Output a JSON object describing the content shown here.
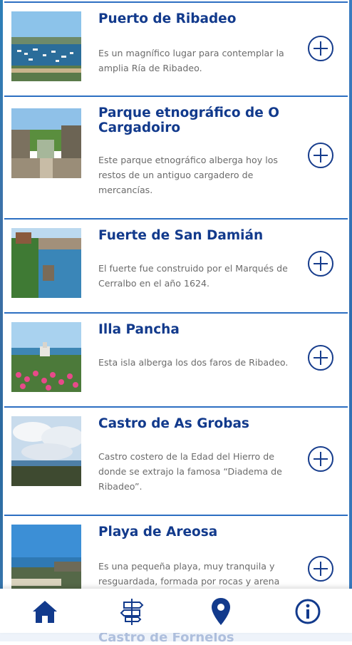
{
  "places": [
    {
      "title": "Puerto de Ribadeo",
      "description": "Es un magnífico lugar para contemplar la amplia Ría de Ribadeo."
    },
    {
      "title": "Parque etnográfico de O Cargadoiro",
      "description": "Este parque etnográfico alberga hoy los restos de un antiguo cargadero de mercancías."
    },
    {
      "title": "Fuerte de San Damián",
      "description": "El fuerte fue construido por el Marqués de Cerralbo en el año 1624."
    },
    {
      "title": "Illa Pancha",
      "description": "Esta isla alberga los dos faros de Ribadeo."
    },
    {
      "title": "Castro de As Grobas",
      "description": "Castro costero de la Edad del Hierro de donde se extrajo la famosa “Diadema de Ribadeo”."
    },
    {
      "title": "Playa de Areosa",
      "description": "Es una pequeña playa, muy tranquila y resguardada, formada por rocas y arena blanca."
    }
  ],
  "next_place_title": "Castro de Fornelos",
  "tabbar": {
    "items": [
      "home-icon",
      "signpost-icon",
      "map-pin-icon",
      "info-icon"
    ],
    "accent": "#123a8c"
  },
  "colors": {
    "title": "#123a8c",
    "border": "#2d6fc2",
    "text": "#6b6b6b"
  }
}
